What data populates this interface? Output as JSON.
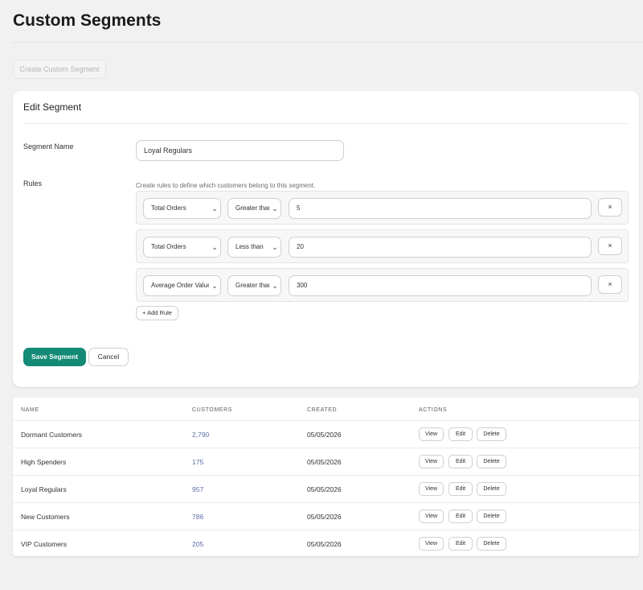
{
  "page": {
    "title": "Custom Segments",
    "create_button_label": "Create Custom Segment"
  },
  "edit_segment": {
    "title": "Edit Segment",
    "name_label": "Segment Name",
    "name_value": "Loyal Regulars",
    "rules_label": "Rules",
    "rules_help": "Create rules to define which customers belong to this segment.",
    "rules": [
      {
        "field": "Total Orders",
        "operator": "Greater than",
        "value": "5",
        "remove_label": "×"
      },
      {
        "field": "Total Orders",
        "operator": "Less than",
        "value": "20",
        "remove_label": "×"
      },
      {
        "field": "Average Order Value",
        "operator": "Greater than",
        "value": "300",
        "remove_label": "×"
      }
    ],
    "add_rule_label": "+ Add Rule",
    "save_label": "Save Segment",
    "cancel_label": "Cancel"
  },
  "segments_table": {
    "headers": {
      "name": "NAME",
      "customers": "CUSTOMERS",
      "created": "CREATED",
      "actions": "ACTIONS"
    },
    "action_labels": {
      "view": "View",
      "edit": "Edit",
      "delete": "Delete"
    },
    "rows": [
      {
        "name": "Dormant Customers",
        "customers": "2,790",
        "created": "05/05/2026"
      },
      {
        "name": "High Spenders",
        "customers": "175",
        "created": "05/05/2026"
      },
      {
        "name": "Loyal Regulars",
        "customers": "957",
        "created": "05/05/2026"
      },
      {
        "name": "New Customers",
        "customers": "786",
        "created": "05/05/2026"
      },
      {
        "name": "VIP Customers",
        "customers": "205",
        "created": "05/05/2026"
      }
    ]
  },
  "colors": {
    "primary": "#138a76",
    "link": "#5b6fa8",
    "background": "#f1f1f1"
  },
  "icons": {
    "select_arrow": "chevron-down-icon",
    "remove_rule": "close-icon"
  }
}
